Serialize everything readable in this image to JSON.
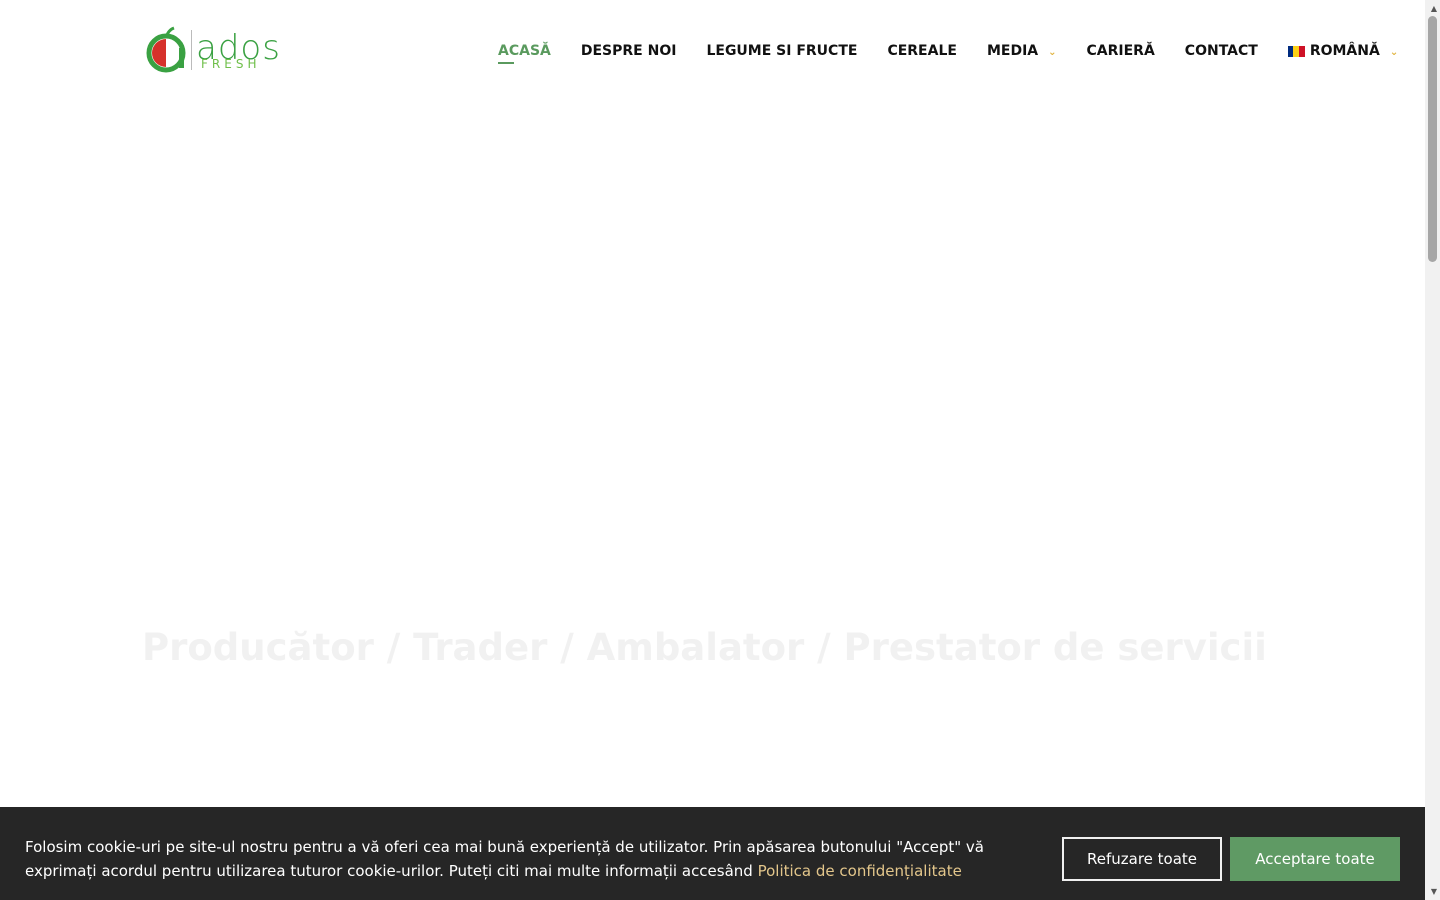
{
  "brand": {
    "name": "ados",
    "tagline": "FRESH",
    "colors": {
      "primary": "#3aa142",
      "accent_red": "#d6312b"
    }
  },
  "nav": {
    "items": [
      {
        "label": "ACASĂ",
        "active": true
      },
      {
        "label": "DESPRE NOI"
      },
      {
        "label": "LEGUME SI FRUCTE"
      },
      {
        "label": "CEREALE"
      },
      {
        "label": "MEDIA",
        "has_dropdown": true
      },
      {
        "label": "CARIERĂ"
      },
      {
        "label": "CONTACT"
      }
    ],
    "language": {
      "label": "ROMÂNĂ",
      "flag": "romania-flag-icon"
    }
  },
  "hero": {
    "title": "Producător / Trader / Ambalator / Prestator de servicii"
  },
  "cookie_banner": {
    "text": "Folosim cookie-uri pe site-ul nostru pentru a vă oferi cea mai bună experiență de utilizator. Prin apăsarea butonului \"Accept\" vă exprimați acordul pentru utilizarea tuturor cookie-urilor. Puteți citi mai multe informații accesând",
    "link_label": "Politica de confidențialitate",
    "refuse_label": "Refuzare toate",
    "accept_label": "Acceptare toate",
    "colors": {
      "background": "#262626",
      "accept": "#5f9a64",
      "link": "#e3c68b"
    }
  }
}
